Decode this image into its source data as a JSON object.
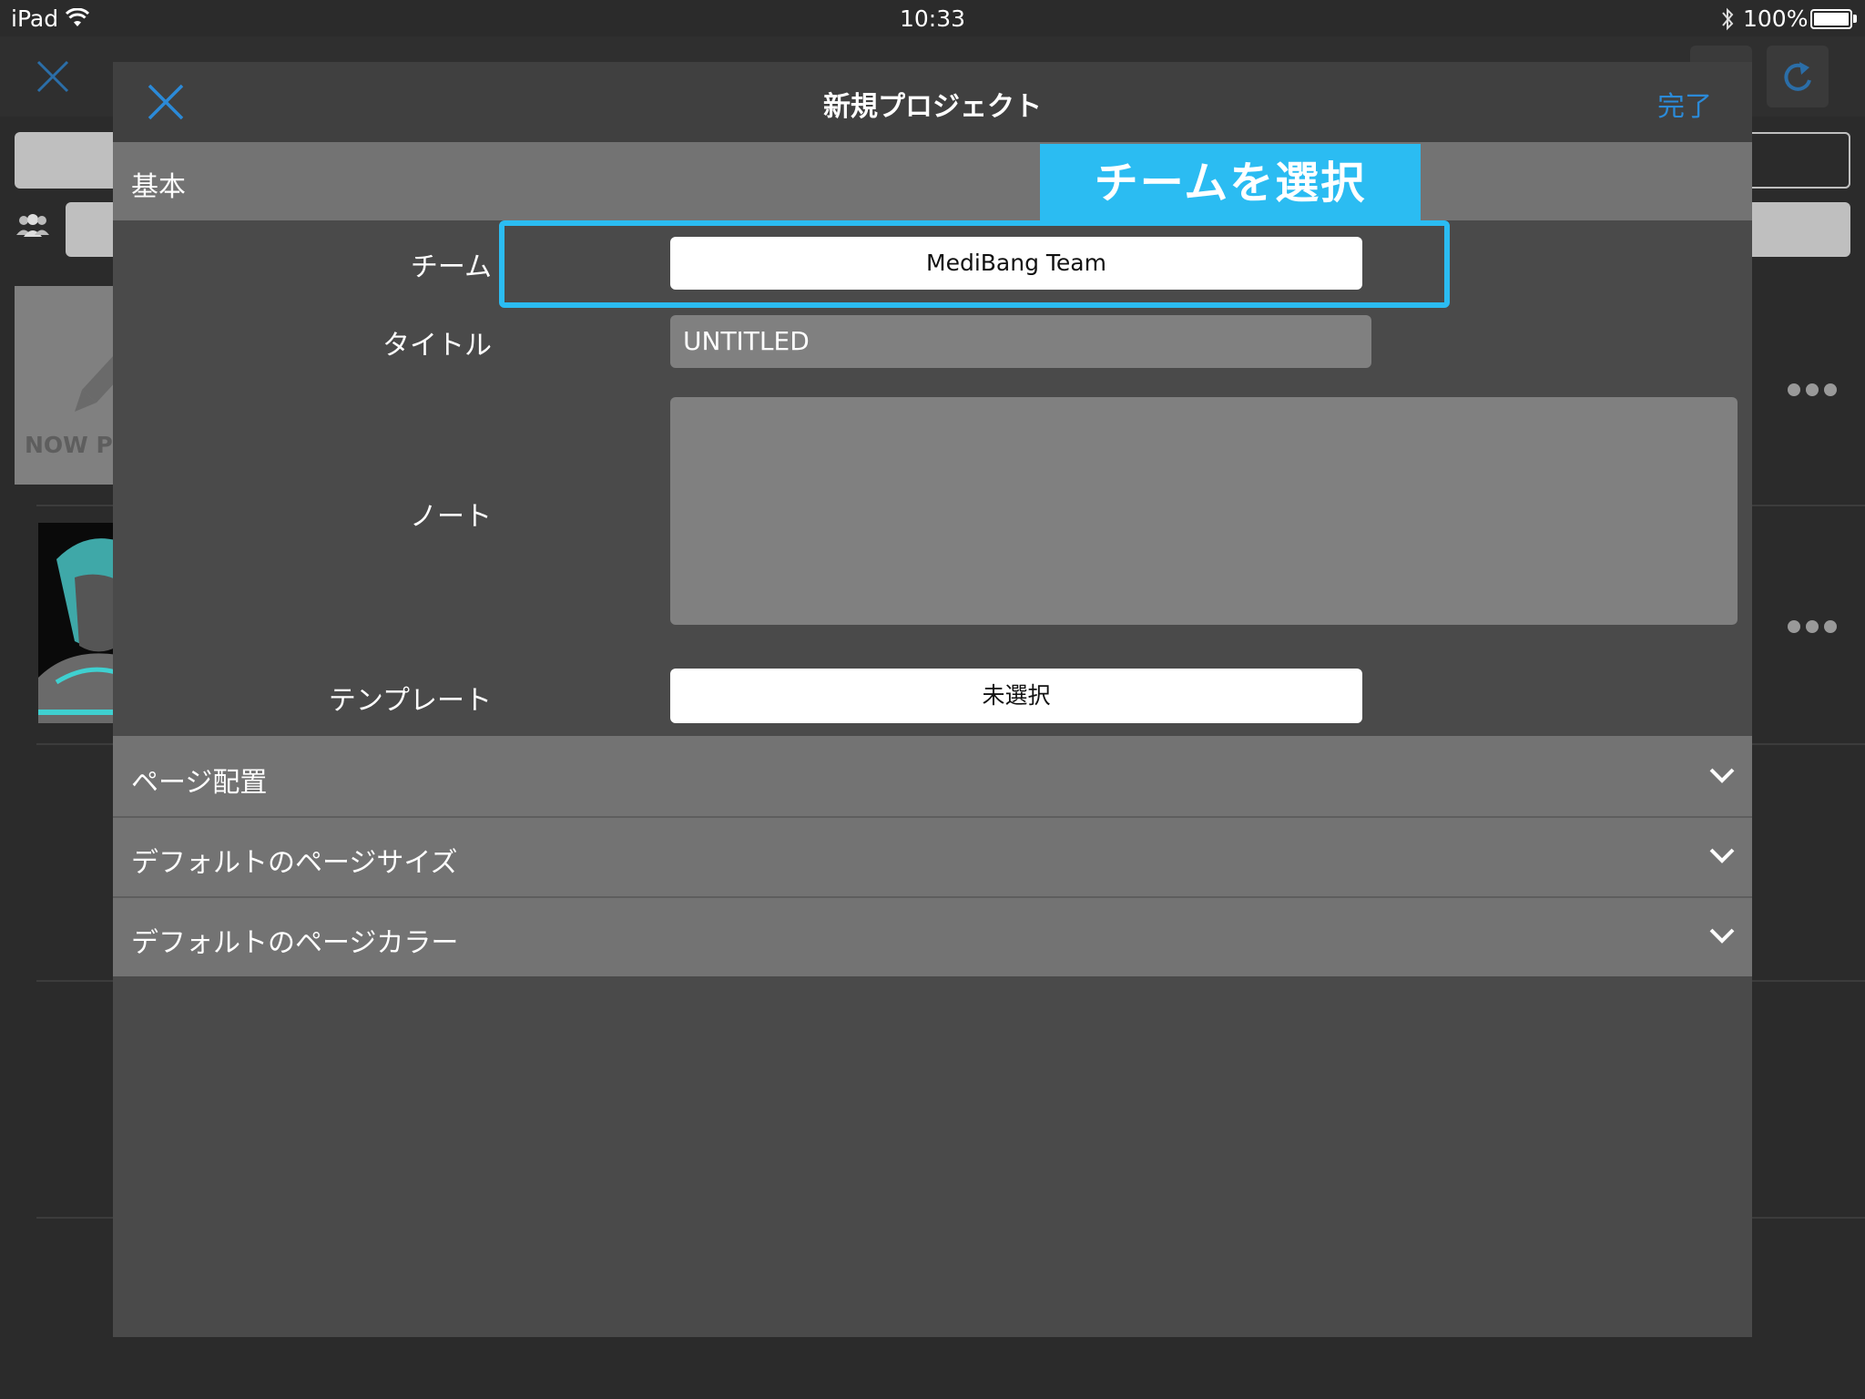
{
  "status_bar": {
    "device": "iPad",
    "time": "10:33",
    "battery": "100%"
  },
  "background": {
    "thumbnail_label": "NOW PR"
  },
  "modal": {
    "title": "新規プロジェクト",
    "done_label": "完了",
    "basic_section": "基本",
    "callout": "チームを選択",
    "fields": {
      "team_label": "チーム",
      "team_value": "MediBang Team",
      "title_label": "タイトル",
      "title_value": "UNTITLED",
      "note_label": "ノート",
      "note_value": "",
      "template_label": "テンプレート",
      "template_value": "未選択"
    },
    "sections": [
      {
        "label": "ページ配置"
      },
      {
        "label": "デフォルトのページサイズ"
      },
      {
        "label": "デフォルトのページカラー"
      }
    ]
  },
  "colors": {
    "accent": "#2bbcf2",
    "done_link": "#2b8ad8"
  }
}
